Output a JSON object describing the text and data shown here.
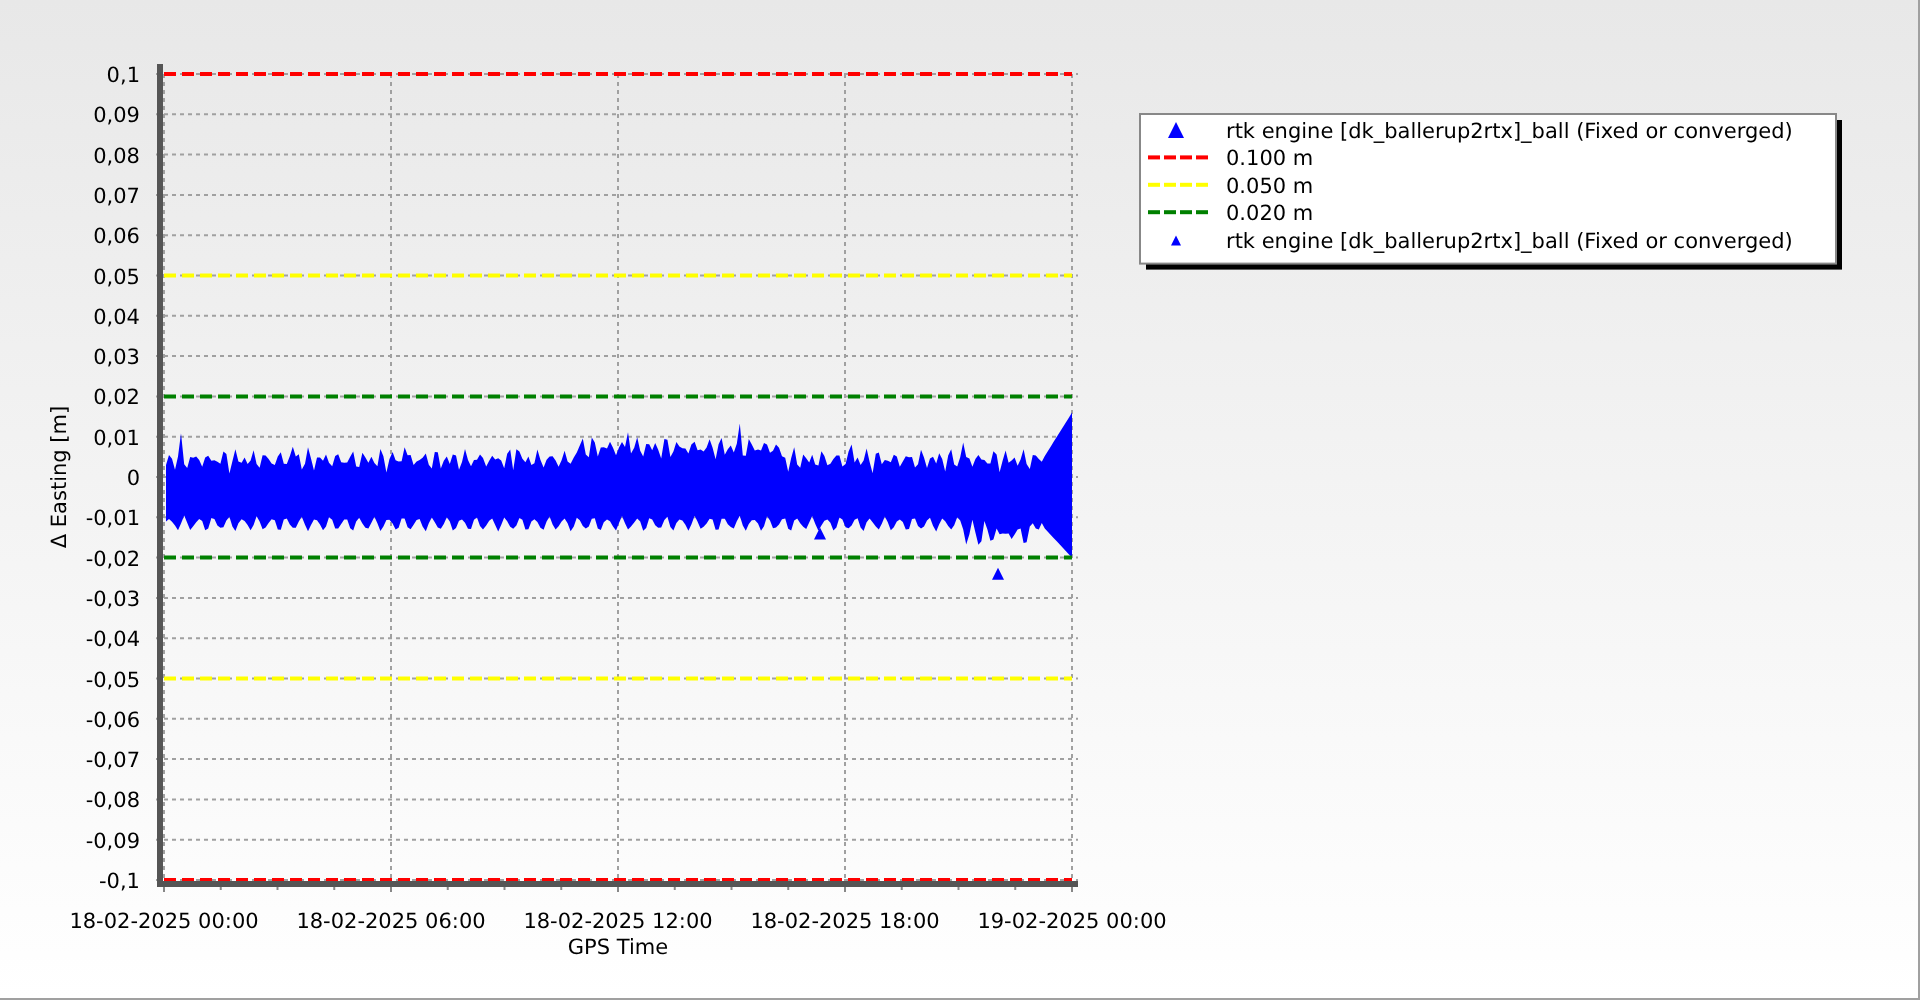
{
  "chart_data": {
    "type": "line",
    "xlabel": "GPS Time",
    "ylabel": "Δ Easting [m]",
    "categories": [
      "18-02-2025 00:00",
      "18-02-2025 06:00",
      "18-02-2025 12:00",
      "18-02-2025 18:00",
      "19-02-2025 00:00"
    ],
    "ylim": [
      -0.1,
      0.1
    ],
    "grid": true,
    "yticks": [
      {
        "value": 0.1,
        "label": "0,1"
      },
      {
        "value": 0.09,
        "label": "0,09"
      },
      {
        "value": 0.08,
        "label": "0,08"
      },
      {
        "value": 0.07,
        "label": "0,07"
      },
      {
        "value": 0.06,
        "label": "0,06"
      },
      {
        "value": 0.05,
        "label": "0,05"
      },
      {
        "value": 0.04,
        "label": "0,04"
      },
      {
        "value": 0.03,
        "label": "0,03"
      },
      {
        "value": 0.02,
        "label": "0,02"
      },
      {
        "value": 0.01,
        "label": "0,01"
      },
      {
        "value": 0,
        "label": "0"
      },
      {
        "value": -0.01,
        "label": "-0,01"
      },
      {
        "value": -0.02,
        "label": "-0,02"
      },
      {
        "value": -0.03,
        "label": "-0,03"
      },
      {
        "value": -0.04,
        "label": "-0,04"
      },
      {
        "value": -0.05,
        "label": "-0,05"
      },
      {
        "value": -0.06,
        "label": "-0,06"
      },
      {
        "value": -0.07,
        "label": "-0,07"
      },
      {
        "value": -0.08,
        "label": "-0,08"
      },
      {
        "value": -0.09,
        "label": "-0,09"
      },
      {
        "value": -0.1,
        "label": "-0,1"
      }
    ],
    "series": [
      {
        "color": "#ff0000",
        "line_style": "dashed",
        "values": [
          0.1,
          0.1,
          0.1,
          0.1,
          0.1
        ]
      },
      {
        "color": "#ff0000",
        "line_style": "dashed",
        "values": [
          -0.1,
          -0.1,
          -0.1,
          -0.1,
          -0.1
        ]
      },
      {
        "color": "#ffff00",
        "line_style": "dashed",
        "values": [
          0.05,
          0.05,
          0.05,
          0.05,
          0.05
        ]
      },
      {
        "color": "#ffff00",
        "line_style": "dashed",
        "values": [
          -0.05,
          -0.05,
          -0.05,
          -0.05,
          -0.05
        ]
      },
      {
        "color": "#008000",
        "line_style": "dashed",
        "values": [
          0.02,
          0.02,
          0.02,
          0.02,
          0.02
        ]
      },
      {
        "color": "#008000",
        "line_style": "dashed",
        "values": [
          -0.02,
          -0.02,
          -0.02,
          -0.02,
          -0.02
        ]
      }
    ]
  },
  "legend": [
    {
      "kind": "triangle-large",
      "color": "#0000ff",
      "label": "rtk engine [dk_ballerup2rtx]_ball (Fixed or converged)"
    },
    {
      "kind": "dashed",
      "color": "#ff0000",
      "label": "0.100 m"
    },
    {
      "kind": "dashed",
      "color": "#ffff00",
      "label": "0.050 m"
    },
    {
      "kind": "dashed",
      "color": "#008000",
      "label": "0.020 m"
    },
    {
      "kind": "triangle-small",
      "color": "#0000ff",
      "label": "rtk engine [dk_ballerup2rtx]_ball (Fixed or converged)"
    }
  ]
}
